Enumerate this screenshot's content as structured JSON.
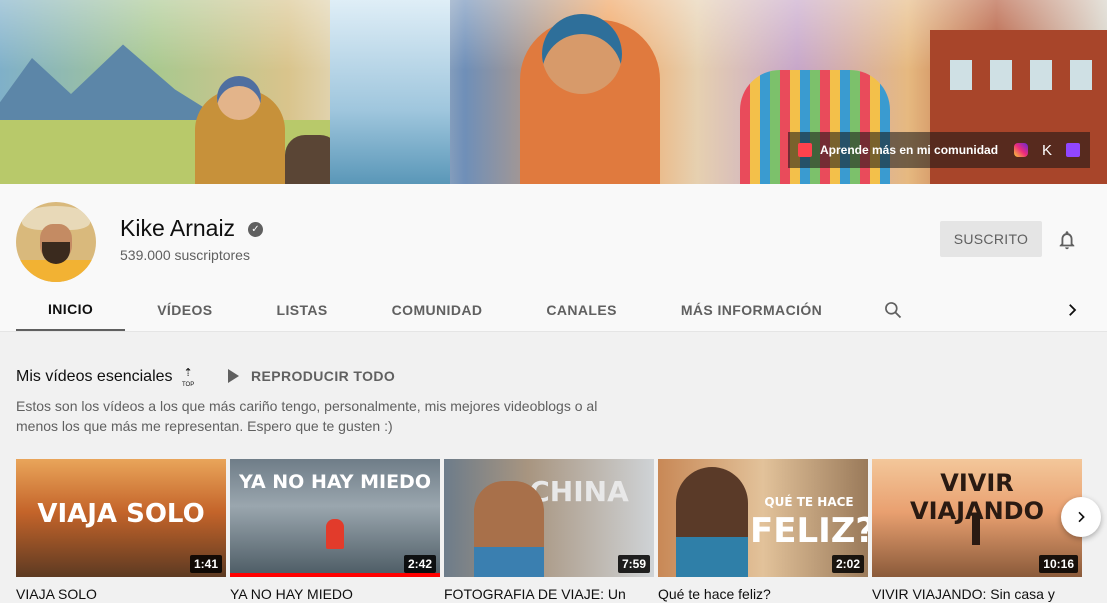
{
  "banner": {
    "community_text": "Aprende más en mi comunidad",
    "links": [
      "instagram-icon",
      "k-icon",
      "twitch-icon"
    ],
    "k_glyph": "K"
  },
  "channel": {
    "name": "Kike Arnaiz",
    "subscribers": "539.000 suscriptores",
    "subscribe_label": "SUSCRITO"
  },
  "tabs": [
    {
      "label": "INICIO",
      "active": true
    },
    {
      "label": "VÍDEOS",
      "active": false
    },
    {
      "label": "LISTAS",
      "active": false
    },
    {
      "label": "COMUNIDAD",
      "active": false
    },
    {
      "label": "CANALES",
      "active": false
    },
    {
      "label": "MÁS INFORMACIÓN",
      "active": false
    }
  ],
  "shelf": {
    "title": "Mis vídeos esenciales",
    "top_badge": "TOP",
    "play_all": "REPRODUCIR TODO",
    "description": "Estos son los vídeos a los que más cariño tengo, personalmente, mis mejores videoblogs o al menos los que más me representan. Espero que te gusten :)"
  },
  "videos": [
    {
      "overlay": "VIAJA SOLO",
      "duration": "1:41",
      "title": "VIAJA SOLO",
      "watched_fraction": 0
    },
    {
      "overlay": "YA NO HAY MIEDO",
      "duration": "2:42",
      "title": "YA NO HAY MIEDO",
      "watched_fraction": 1
    },
    {
      "overlay": "CHINA",
      "duration": "7:59",
      "title": "FOTOGRAFIA DE VIAJE: Un",
      "watched_fraction": 0
    },
    {
      "overlay_line1": "QUÉ TE HACE",
      "overlay_line2": "FELIZ?",
      "duration": "2:02",
      "title": "Qué te hace feliz?",
      "watched_fraction": 0
    },
    {
      "overlay": "VIVIR VIAJANDO",
      "duration": "10:16",
      "title": "VIVIR VIAJANDO: Sin casa y",
      "watched_fraction": 0
    }
  ],
  "colors": {
    "progress": "#ff0000",
    "background": "#f9f9f9",
    "shelf_bg": "#f1f1f1"
  }
}
